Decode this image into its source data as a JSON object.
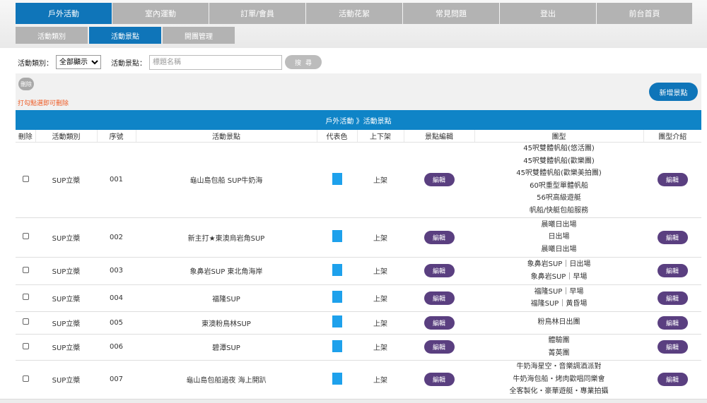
{
  "main_nav": [
    {
      "label": "戶外活動",
      "active": true
    },
    {
      "label": "室內運動",
      "active": false
    },
    {
      "label": "訂單/會員",
      "active": false
    },
    {
      "label": "活動花絮",
      "active": false
    },
    {
      "label": "常見問題",
      "active": false
    },
    {
      "label": "登出",
      "active": false
    },
    {
      "label": "前台首頁",
      "active": false
    }
  ],
  "sub_nav": [
    {
      "label": "活動類別",
      "active": false
    },
    {
      "label": "活動景點",
      "active": true
    },
    {
      "label": "開團管理",
      "active": false
    }
  ],
  "filters": {
    "category_label": "活動類別：",
    "category_value": "全部顯示",
    "spot_label": "活動景點：",
    "spot_placeholder": "標題名稱",
    "search_label": "搜尋"
  },
  "actions": {
    "delete_label": "刪除",
    "hint": "打勾點選即可刪除",
    "add_label": "新增景點"
  },
  "table": {
    "title": "戶外活動 》活動景點",
    "columns": [
      "刪除",
      "活動類別",
      "序號",
      "活動景點",
      "代表色",
      "上下架",
      "景點編輯",
      "團型",
      "團型介紹"
    ],
    "edit_label": "編輯",
    "swatch_color": "#1ea1ec",
    "rows": [
      {
        "category": "SUP立槳",
        "no": "001",
        "spot": "龜山島包船 SUP牛奶海",
        "status": "上架",
        "types": [
          "45呎雙體帆船(悠活團)",
          "45呎雙體帆船(歡樂團)",
          "45呎雙體帆船(歡樂美拍團)",
          "60呎重型單體帆船",
          "56呎高級遊艇",
          "帆船/快艇包船服務"
        ]
      },
      {
        "category": "SUP立槳",
        "no": "002",
        "spot": "新主打★東澳烏岩角SUP",
        "status": "上架",
        "types": [
          "晨曦日出場",
          "日出場",
          "晨曦日出場"
        ]
      },
      {
        "category": "SUP立槳",
        "no": "003",
        "spot": "象鼻岩SUP 東北角海岸",
        "status": "上架",
        "types": [
          "象鼻岩SUP｜日出場",
          "象鼻岩SUP｜早場"
        ]
      },
      {
        "category": "SUP立槳",
        "no": "004",
        "spot": "福隆SUP",
        "status": "上架",
        "types": [
          "福隆SUP｜早場",
          "福隆SUP｜黃昏場"
        ]
      },
      {
        "category": "SUP立槳",
        "no": "005",
        "spot": "東澳粉鳥林SUP",
        "status": "上架",
        "types": [
          "粉鳥林日出團"
        ]
      },
      {
        "category": "SUP立槳",
        "no": "006",
        "spot": "碧潭SUP",
        "status": "上架",
        "types": [
          "體驗團",
          "菁英團"
        ]
      },
      {
        "category": "SUP立槳",
        "no": "007",
        "spot": "龜山島包船過夜 海上開趴",
        "status": "上架",
        "types": [
          "牛奶海星空・音樂調酒派對",
          "牛奶海包船・烤肉歡唱同樂會",
          "全客製化・豪華遊艇・專業拍攝"
        ]
      }
    ]
  }
}
